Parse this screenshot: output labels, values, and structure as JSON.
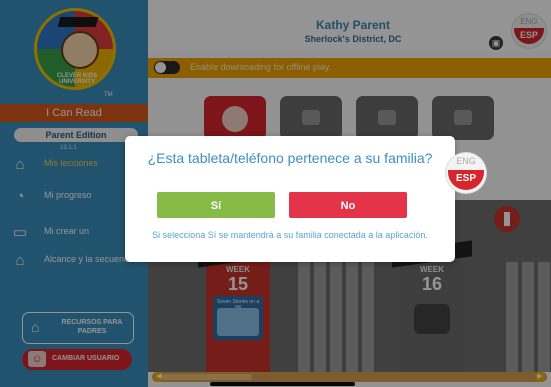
{
  "sidebar": {
    "logo_text": "CLEVER KIDS UNIVERSITY",
    "trademark": "TM",
    "app_name": "I Can Read",
    "edition": "Parent Edition",
    "version": "13.1.1",
    "nav": [
      {
        "label": "Mis lecciones",
        "icon": "home-icon"
      },
      {
        "label": "Mi progreso",
        "icon": "progress-icon"
      },
      {
        "label": "Mi crear un",
        "icon": "book-icon"
      },
      {
        "label": "Alcance y la secuencia",
        "icon": "house-icon"
      }
    ],
    "resources_label": "RECURSOS PARA PADRES",
    "switch_user_label": "CAMBIAR USUARIO"
  },
  "header": {
    "user_name": "Kathy Parent",
    "district": "Sherlock's District, DC",
    "lang_eng": "ENG",
    "lang_esp": "ESP"
  },
  "offline": {
    "label": "Enable downloading for offline play.",
    "enabled": false
  },
  "scene": {
    "houses": [
      {
        "week_label": "WEEK",
        "week_number": "15",
        "book_title": "Seven Stories on a Hill",
        "locked": false
      },
      {
        "week_label": "WEEK",
        "week_number": "16",
        "locked": true
      }
    ]
  },
  "dialog": {
    "question": "¿Esta tableta/teléfono pertenece a su familia?",
    "yes_label": "Sí",
    "no_label": "No",
    "note": "Si selecciona Sí se mantendrá a su familia conectada a la aplicación.",
    "lang_eng": "ENG",
    "lang_esp": "ESP"
  },
  "colors": {
    "sidebar": "#3b8fbd",
    "accent_orange": "#f0a200",
    "yes_green": "#87bb47",
    "no_red": "#e4344a",
    "title_blue": "#3c8fbf"
  }
}
